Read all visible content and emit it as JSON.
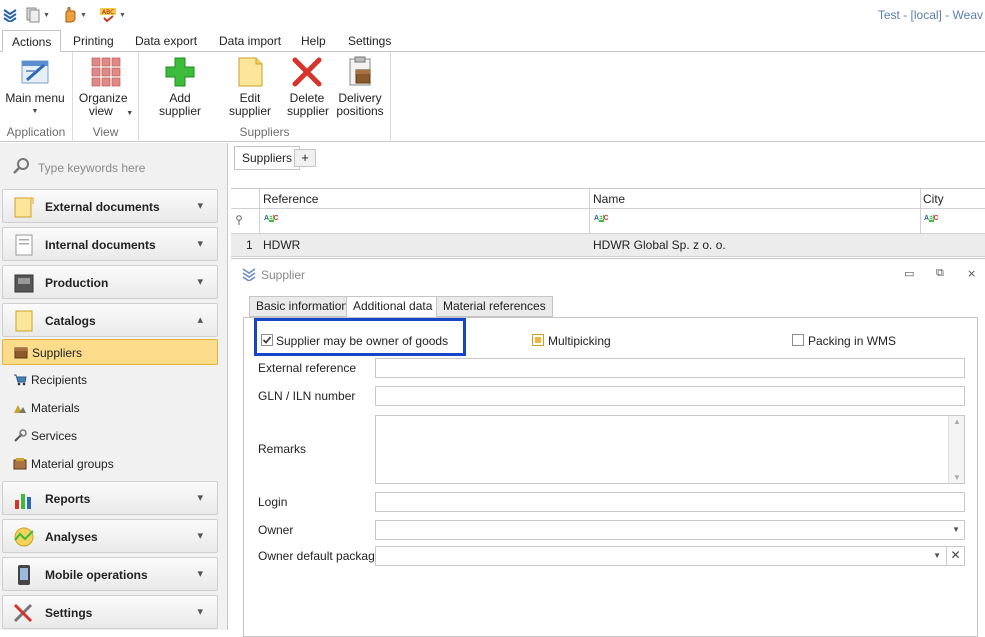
{
  "window": {
    "title": "Test - [local] - Weav"
  },
  "ribbon_tabs": [
    "Actions",
    "Printing",
    "Data export",
    "Data import",
    "Help",
    "Settings"
  ],
  "ribbon": {
    "groups": {
      "application": "Application",
      "view": "View",
      "suppliers": "Suppliers"
    },
    "buttons": {
      "main_menu": "Main menu",
      "organize_view": "Organize view",
      "add_supplier": "Add supplier",
      "edit_supplier": "Edit supplier",
      "delete_supplier": "Delete supplier",
      "delivery_positions": "Delivery positions"
    }
  },
  "sidebar": {
    "search_placeholder": "Type keywords here",
    "groups": [
      {
        "label": "External documents",
        "icon": "external-documents-icon"
      },
      {
        "label": "Internal documents",
        "icon": "internal-documents-icon"
      },
      {
        "label": "Production",
        "icon": "production-icon"
      },
      {
        "label": "Catalogs",
        "icon": "catalogs-icon",
        "expanded": true
      },
      {
        "label": "Reports",
        "icon": "reports-icon"
      },
      {
        "label": "Analyses",
        "icon": "analyses-icon"
      },
      {
        "label": "Mobile operations",
        "icon": "mobile-operations-icon"
      },
      {
        "label": "Settings",
        "icon": "settings-icon"
      }
    ],
    "catalog_items": [
      {
        "label": "Suppliers",
        "selected": true
      },
      {
        "label": "Recipients"
      },
      {
        "label": "Materials"
      },
      {
        "label": "Services"
      },
      {
        "label": "Material groups"
      }
    ]
  },
  "doc_tabs": {
    "active": "Suppliers",
    "add": "+"
  },
  "grid": {
    "columns": [
      "Reference",
      "Name",
      "City"
    ],
    "filter_glyph": "ABC",
    "rows": [
      {
        "num": "1",
        "reference": "HDWR",
        "name": "HDWR Global Sp. z o. o.",
        "city": ""
      }
    ]
  },
  "panel": {
    "title": "Supplier",
    "tabs": [
      "Basic information",
      "Additional data",
      "Material references"
    ],
    "active_tab": "Additional data",
    "checkboxes": {
      "owner_of_goods": {
        "label": "Supplier may be owner of goods",
        "checked": true
      },
      "multipicking": {
        "label": "Multipicking",
        "state": "indeterminate"
      },
      "packing_in_wms": {
        "label": "Packing in WMS",
        "checked": false
      }
    },
    "fields": {
      "external_reference": {
        "label": "External reference",
        "value": ""
      },
      "gln_iln": {
        "label": "GLN / ILN number",
        "value": ""
      },
      "remarks": {
        "label": "Remarks",
        "value": ""
      },
      "login": {
        "label": "Login",
        "value": ""
      },
      "owner": {
        "label": "Owner",
        "value": ""
      },
      "owner_default_package": {
        "label": "Owner default package",
        "value": ""
      }
    }
  },
  "colors": {
    "highlight": "#1546c7",
    "selected_item": "#fbdc8a",
    "title_text": "#5a7fb0"
  }
}
